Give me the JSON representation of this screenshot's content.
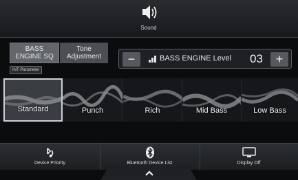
{
  "header": {
    "title": "Sound",
    "icon": "speaker-icon"
  },
  "tabs": [
    {
      "label": "BASS\nENGINE SQ",
      "selected": true
    },
    {
      "label": "Tone\nAdjustment",
      "selected": false
    }
  ],
  "int_parameter": "INT Parameter",
  "level": {
    "minus": "−",
    "plus": "+",
    "label": "BASS ENGINE Level",
    "value": "03",
    "icon": "bars-icon"
  },
  "presets": [
    {
      "label": "Standard",
      "selected": true
    },
    {
      "label": "Punch",
      "selected": false
    },
    {
      "label": "Rich",
      "selected": false
    },
    {
      "label": "Mid Bass",
      "selected": false
    },
    {
      "label": "Low Bass",
      "selected": false
    }
  ],
  "bottom": {
    "device_priority": "Device Priority",
    "bt_list": "Bluetooth Device List",
    "display_off": "Display Off"
  },
  "colors": {
    "background": "#0b0c0e",
    "panel": "#2a2c30",
    "accent": "#cfd2d4"
  }
}
